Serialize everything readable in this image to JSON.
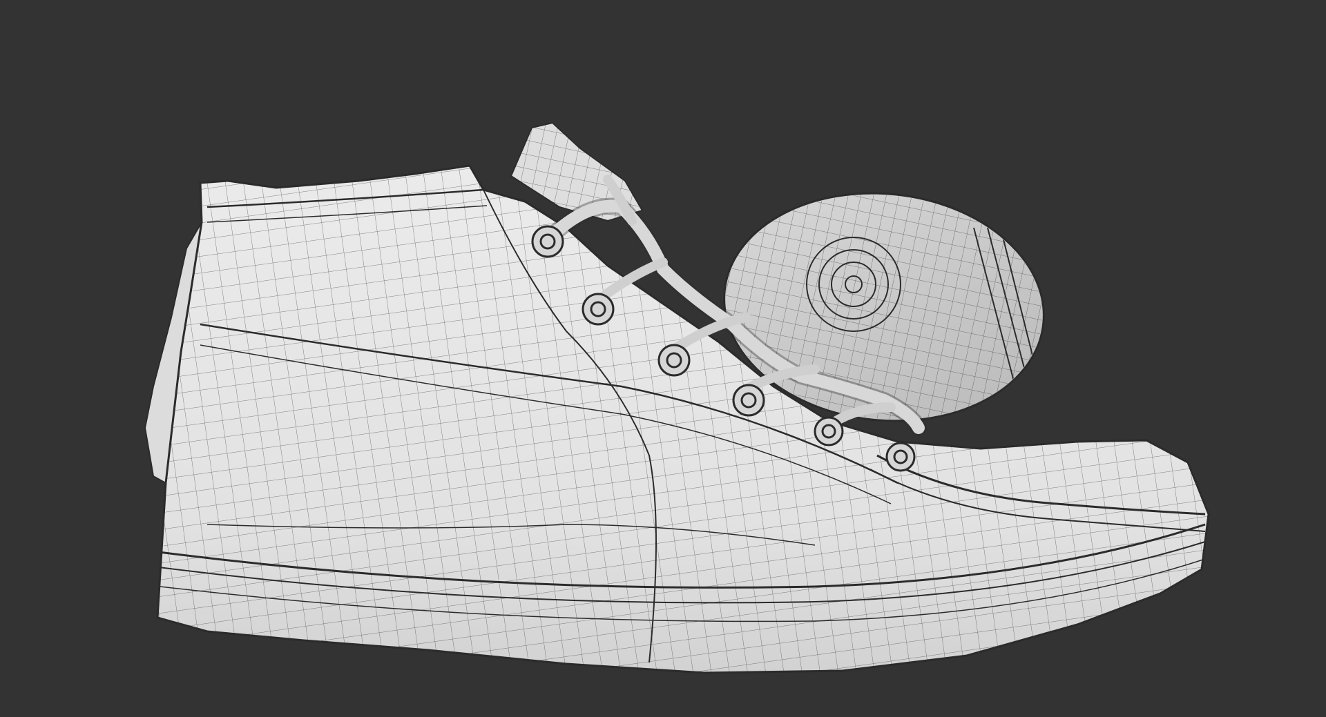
{
  "scene": {
    "subject": "sneaker-wireframe-render",
    "colors": {
      "background": "#333333",
      "surface": "#e6e6e6",
      "surface_shadow": "#bdbdbd",
      "wire": "#2b2b2b"
    },
    "objects": [
      {
        "name": "high-top-sneaker",
        "icon": "shoe-icon"
      },
      {
        "name": "second-sneaker-sole",
        "icon": "sole-icon"
      },
      {
        "name": "laces",
        "icon": "lace-icon"
      },
      {
        "name": "eyelets",
        "icon": "eyelet-icon",
        "count": 6
      }
    ]
  }
}
